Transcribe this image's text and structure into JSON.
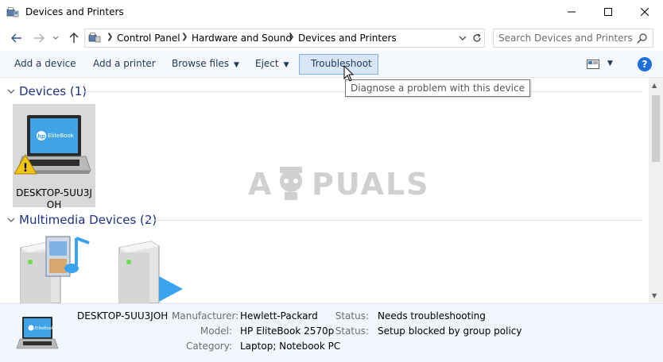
{
  "window": {
    "title": "Devices and Printers"
  },
  "address": {
    "crumbs": [
      "Control Panel",
      "Hardware and Sound",
      "Devices and Printers"
    ]
  },
  "search": {
    "placeholder": "Search Devices and Printers"
  },
  "toolbar": {
    "add_device": "Add a device",
    "add_printer": "Add a printer",
    "browse_files": "Browse files",
    "eject": "Eject",
    "troubleshoot": "Troubleshoot",
    "help": "?"
  },
  "tooltip": "Diagnose a problem with this device",
  "groups": {
    "devices": {
      "title": "Devices (1)",
      "items": [
        {
          "label_line1": "DESKTOP-5UU3J",
          "label_line2": "OH",
          "laptop_brand": "EliteBook",
          "laptop_logo": "hp",
          "warning": true
        }
      ]
    },
    "multimedia": {
      "title": "Multimedia Devices (2)"
    }
  },
  "details": {
    "name": "DESKTOP-5UU3JOH",
    "thumb_brand": "EliteBook",
    "manufacturer_key": "Manufacturer:",
    "manufacturer": "Hewlett-Packard",
    "model_key": "Model:",
    "model": "HP EliteBook 2570p",
    "category_key": "Category:",
    "category": "Laptop; Notebook PC",
    "status_key": "Status:",
    "status1": "Needs troubleshooting",
    "status2": "Setup blocked by group policy"
  },
  "watermark": {
    "text_left": "A",
    "text_right": "PUALS"
  },
  "colors": {
    "group_header": "#1e3287",
    "command_text": "#1e395b",
    "command_bar_bg": "#f5f8fc",
    "hover_bg": "#d8e6f7",
    "hover_border": "#7eb4ea",
    "details_bg": "#f2f6fc",
    "help_blue": "#1e6fd9"
  }
}
